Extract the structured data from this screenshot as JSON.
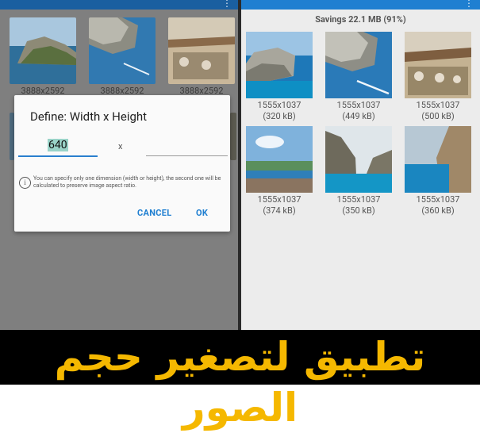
{
  "left_screen": {
    "thumbnails": [
      {
        "caption": "3888x2592",
        "icon": "landscape-photo-icon"
      },
      {
        "caption": "3888x2592",
        "icon": "landscape-photo-icon"
      },
      {
        "caption": "3888x2592",
        "icon": "landscape-photo-icon"
      }
    ],
    "dialog": {
      "title": "Define: Width x Height",
      "width_value": "640",
      "separator": "x",
      "height_value": "",
      "info_text": "You can specify only one dimension (width or height), the second one will be calculated to preserve image aspect ratio.",
      "cancel_label": "CANCEL",
      "ok_label": "OK"
    }
  },
  "right_screen": {
    "savings": "Savings 22.1 MB (91%)",
    "images": [
      {
        "dims": "1555x1037",
        "size": "(320 kB)"
      },
      {
        "dims": "1555x1037",
        "size": "(449 kB)"
      },
      {
        "dims": "1555x1037",
        "size": "(500 kB)"
      },
      {
        "dims": "1555x1037",
        "size": "(374 kB)"
      },
      {
        "dims": "1555x1037",
        "size": "(350 kB)"
      },
      {
        "dims": "1555x1037",
        "size": "(360 kB)"
      }
    ]
  },
  "banner": {
    "text": "تطبيق لتصغير حجم الصور"
  },
  "colors": {
    "accent": "#1f7fd1",
    "banner_text": "#f5b800",
    "banner_bg": "#000000"
  }
}
